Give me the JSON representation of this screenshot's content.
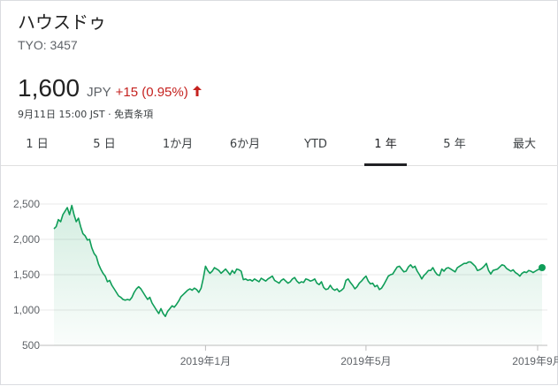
{
  "header": {
    "company": "ハウスドゥ",
    "ticker": "TYO: 3457",
    "price": "1,600",
    "currency": "JPY",
    "change": "+15 (0.95%)",
    "timestamp": "9月11日 15:00 JST · 免責条項"
  },
  "tabs": [
    "1 日",
    "5 日",
    "1か月",
    "6か月",
    "YTD",
    "1 年",
    "5 年",
    "最大"
  ],
  "active_tab": "1 年",
  "colors": {
    "line": "#0f9d58",
    "negative": "#c5221f",
    "grid": "#e8e8e8"
  },
  "chart_data": {
    "type": "area",
    "title": "",
    "xlabel": "",
    "ylabel": "",
    "ylim": [
      500,
      2700
    ],
    "y_ticks": [
      500,
      1000,
      1500,
      2000,
      2500
    ],
    "y_tick_labels": [
      "500",
      "1,000",
      "1,500",
      "2,000",
      "2,500"
    ],
    "x_tick_labels": [
      "2019年1月",
      "2019年5月",
      "2019年9月"
    ],
    "x_tick_index": [
      68,
      140,
      217
    ],
    "last_point_marker": true,
    "series": [
      {
        "values": [
          2150,
          2180,
          2280,
          2250,
          2350,
          2400,
          2450,
          2350,
          2480,
          2350,
          2250,
          2300,
          2180,
          2080,
          2050,
          1990,
          2000,
          1880,
          1800,
          1760,
          1650,
          1580,
          1520,
          1480,
          1400,
          1420,
          1350,
          1300,
          1250,
          1200,
          1180,
          1150,
          1140,
          1150,
          1140,
          1180,
          1250,
          1300,
          1330,
          1300,
          1250,
          1200,
          1150,
          1180,
          1100,
          1050,
          1000,
          950,
          1020,
          950,
          910,
          980,
          1020,
          1060,
          1040,
          1080,
          1130,
          1190,
          1220,
          1250,
          1280,
          1300,
          1280,
          1310,
          1290,
          1250,
          1310,
          1450,
          1620,
          1560,
          1520,
          1550,
          1600,
          1580,
          1560,
          1520,
          1550,
          1580,
          1540,
          1500,
          1560,
          1520,
          1580,
          1570,
          1550,
          1430,
          1440,
          1420,
          1430,
          1410,
          1440,
          1420,
          1400,
          1450,
          1430,
          1410,
          1440,
          1460,
          1480,
          1420,
          1400,
          1380,
          1420,
          1440,
          1410,
          1380,
          1400,
          1440,
          1460,
          1410,
          1380,
          1400,
          1390,
          1440,
          1430,
          1410,
          1420,
          1440,
          1380,
          1360,
          1400,
          1320,
          1290,
          1300,
          1350,
          1300,
          1280,
          1300,
          1260,
          1280,
          1310,
          1420,
          1440,
          1390,
          1350,
          1300,
          1330,
          1380,
          1410,
          1450,
          1480,
          1410,
          1370,
          1380,
          1330,
          1350,
          1290,
          1310,
          1360,
          1420,
          1480,
          1500,
          1510,
          1560,
          1610,
          1620,
          1580,
          1540,
          1550,
          1610,
          1640,
          1600,
          1620,
          1550,
          1500,
          1440,
          1490,
          1520,
          1560,
          1560,
          1600,
          1540,
          1500,
          1490,
          1580,
          1550,
          1590,
          1600,
          1580,
          1560,
          1540,
          1600,
          1620,
          1640,
          1660,
          1660,
          1680,
          1680,
          1650,
          1620,
          1560,
          1570,
          1590,
          1620,
          1660,
          1560,
          1510,
          1560,
          1570,
          1580,
          1610,
          1640,
          1630,
          1590,
          1570,
          1550,
          1570,
          1530,
          1510,
          1480,
          1520,
          1540,
          1530,
          1560,
          1550,
          1530,
          1550,
          1570,
          1580,
          1600
        ]
      }
    ]
  }
}
